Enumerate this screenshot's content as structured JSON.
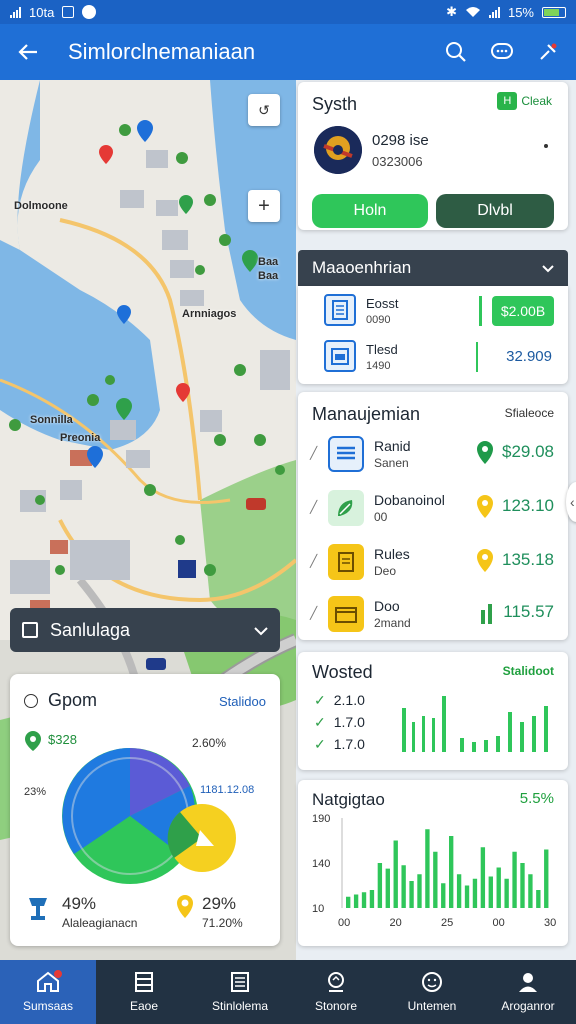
{
  "status_bar": {
    "time": "10ta",
    "battery": "15%"
  },
  "app_bar": {
    "title": "Simlorclnemaniaan"
  },
  "map": {
    "labels": [
      "Dolmoone",
      "Baa",
      "Baa",
      "Arnniagos",
      "Sonnilla",
      "Preonia"
    ]
  },
  "map_dropdown": {
    "label": "Sanlulaga"
  },
  "pie_card": {
    "title": "Gpom",
    "link": "Stalidoo",
    "stat_top_left": "$328",
    "label_top_right": "2.60%",
    "label_left": "23%",
    "label_right": "1181.12.08",
    "footer_left_value": "49%",
    "footer_left_label": "Alaleagianacn",
    "footer_right_value": "29%",
    "footer_right_label": "71.20%",
    "colors": {
      "blue": "#1f7ae0",
      "purple": "#5b5bd6",
      "green": "#2fc65a",
      "yellow": "#f5d020"
    }
  },
  "system_card": {
    "title": "Systh",
    "badge_box": "H",
    "badge_text": "Cleak",
    "line1": "0298 ise",
    "line2": "0323006",
    "btn_green": "Holn",
    "btn_dark": "Dlvbl"
  },
  "section_header": {
    "label": "Maaoenhrian"
  },
  "list1": [
    {
      "title": "Eosst",
      "sub": "0090",
      "value": "$2.00B",
      "style": "green"
    },
    {
      "title": "Tlesd",
      "sub": "1490",
      "value": "32.909",
      "style": "plain"
    }
  ],
  "management": {
    "title": "Manaujemian",
    "link": "Sfialeoce",
    "rows": [
      {
        "title": "Ranid",
        "sub": "Sanen",
        "value": "$29.08",
        "pin_color": "#1f9a4a"
      },
      {
        "title": "Dobanoinol",
        "sub": "00",
        "value": "123.10",
        "pin_color": "#f5c518"
      },
      {
        "title": "Rules",
        "sub": "Deo",
        "value": "135.18",
        "pin_color": "#f5c518"
      },
      {
        "title": "Doo",
        "sub": "2mand",
        "value": "115.57",
        "pin_color": "#2fc65a"
      }
    ]
  },
  "wasted": {
    "title": "Wosted",
    "link": "Stalidoot",
    "rows": [
      "2.1.0",
      "1.7.0",
      "1.7.0"
    ]
  },
  "nav_card": {
    "title": "Natgigtao",
    "pct": "5.5%"
  },
  "chart_data": {
    "type": "bar",
    "title": "Natgigtao",
    "y_ticks": [
      "190",
      "140",
      "10"
    ],
    "x_ticks": [
      "00",
      "20",
      "25",
      "00",
      "30"
    ],
    "values": [
      10,
      12,
      14,
      16,
      40,
      35,
      60,
      38,
      24,
      30,
      70,
      50,
      22,
      64,
      30,
      20,
      26,
      54,
      28,
      36,
      26,
      50,
      40,
      30,
      16,
      52
    ]
  },
  "bottom_nav": [
    {
      "label": "Sumsaas"
    },
    {
      "label": "Eaoe"
    },
    {
      "label": "Stinlolema"
    },
    {
      "label": "Stonore"
    },
    {
      "label": "Untemen"
    },
    {
      "label": "Aroganror"
    }
  ]
}
